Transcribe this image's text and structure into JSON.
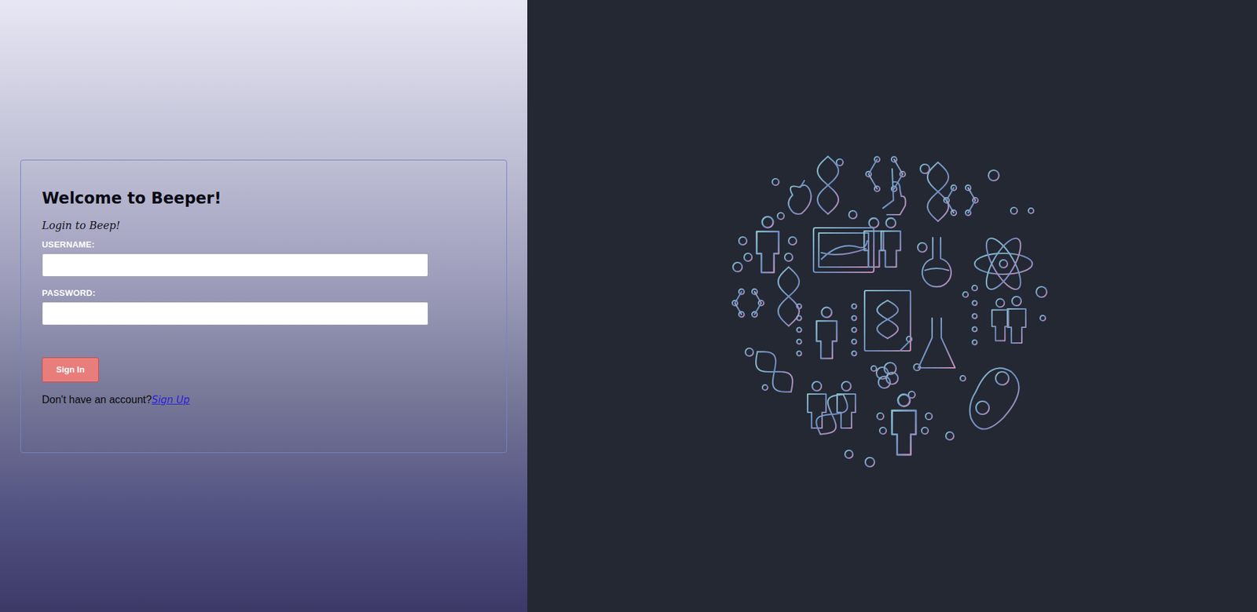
{
  "login": {
    "title": "Welcome to Beeper!",
    "subtitle": "Login to Beep!",
    "fields": [
      {
        "label": "USERNAME:",
        "value": ""
      },
      {
        "label": "PASSWORD:",
        "value": ""
      }
    ],
    "button": "Sign In",
    "prompt": "Don't have an account?",
    "link": "Sign Up"
  }
}
